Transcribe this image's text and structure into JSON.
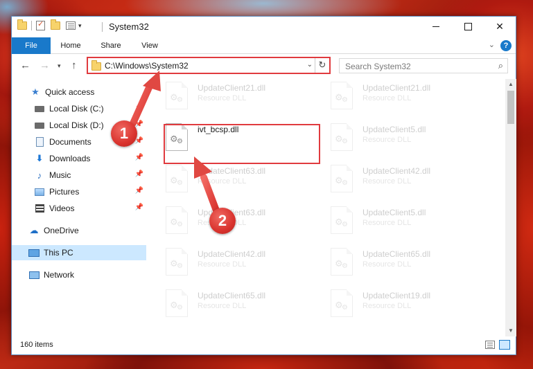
{
  "window": {
    "title": "System32",
    "caption": {
      "minimize": "",
      "maximize": "",
      "close": "✕"
    }
  },
  "ribbon": {
    "tabs": [
      "File",
      "Home",
      "Share",
      "View"
    ],
    "help": "?",
    "collapse": "⌄"
  },
  "nav": {
    "back": "←",
    "forward": "→",
    "recent": "▾",
    "up": "↑",
    "address": "C:\\Windows\\System32",
    "address_dropdown": "⌄",
    "refresh": "↻",
    "search_placeholder": "Search System32",
    "search_icon": "⌕"
  },
  "navpane": {
    "items": [
      {
        "label": "Quick access",
        "icon": "star-icon"
      },
      {
        "label": "Local Disk (C:)",
        "icon": "drive-icon",
        "pinned": true
      },
      {
        "label": "Local Disk (D:)",
        "icon": "drive-icon",
        "pinned": true
      },
      {
        "label": "Documents",
        "icon": "documents-icon",
        "pinned": true
      },
      {
        "label": "Downloads",
        "icon": "downloads-icon",
        "pinned": true
      },
      {
        "label": "Music",
        "icon": "music-icon",
        "pinned": true
      },
      {
        "label": "Pictures",
        "icon": "pictures-icon",
        "pinned": true
      },
      {
        "label": "Videos",
        "icon": "videos-icon",
        "pinned": true
      },
      {
        "label": "OneDrive",
        "icon": "onedrive-icon"
      },
      {
        "label": "This PC",
        "icon": "this-pc-icon",
        "selected": true
      },
      {
        "label": "Network",
        "icon": "network-icon"
      }
    ]
  },
  "files": {
    "left": [
      {
        "name": "UpdateClient21.dll",
        "type": "Resource DLL"
      },
      {
        "name": "ivt_bcsp.dll",
        "type": ""
      },
      {
        "name": "UpdateClient63.dll",
        "type": "Resource DLL"
      },
      {
        "name": "UpdateClient63.dll",
        "type": "Resource DLL"
      },
      {
        "name": "UpdateClient42.dll",
        "type": "Resource DLL"
      },
      {
        "name": "UpdateClient65.dll",
        "type": "Resource DLL"
      }
    ],
    "right": [
      {
        "name": "UpdateClient21.dll",
        "type": "Resource DLL"
      },
      {
        "name": "UpdateClient5.dll",
        "type": "Resource DLL"
      },
      {
        "name": "UpdateClient42.dll",
        "type": "Resource DLL"
      },
      {
        "name": "UpdateClient5.dll",
        "type": "Resource DLL"
      },
      {
        "name": "UpdateClient65.dll",
        "type": "Resource DLL"
      },
      {
        "name": "UpdateClient19.dll",
        "type": "Resource DLL"
      }
    ]
  },
  "status": {
    "count": "160 items"
  },
  "annotations": {
    "step1": "1",
    "step2": "2",
    "color": "#e03a3e"
  }
}
